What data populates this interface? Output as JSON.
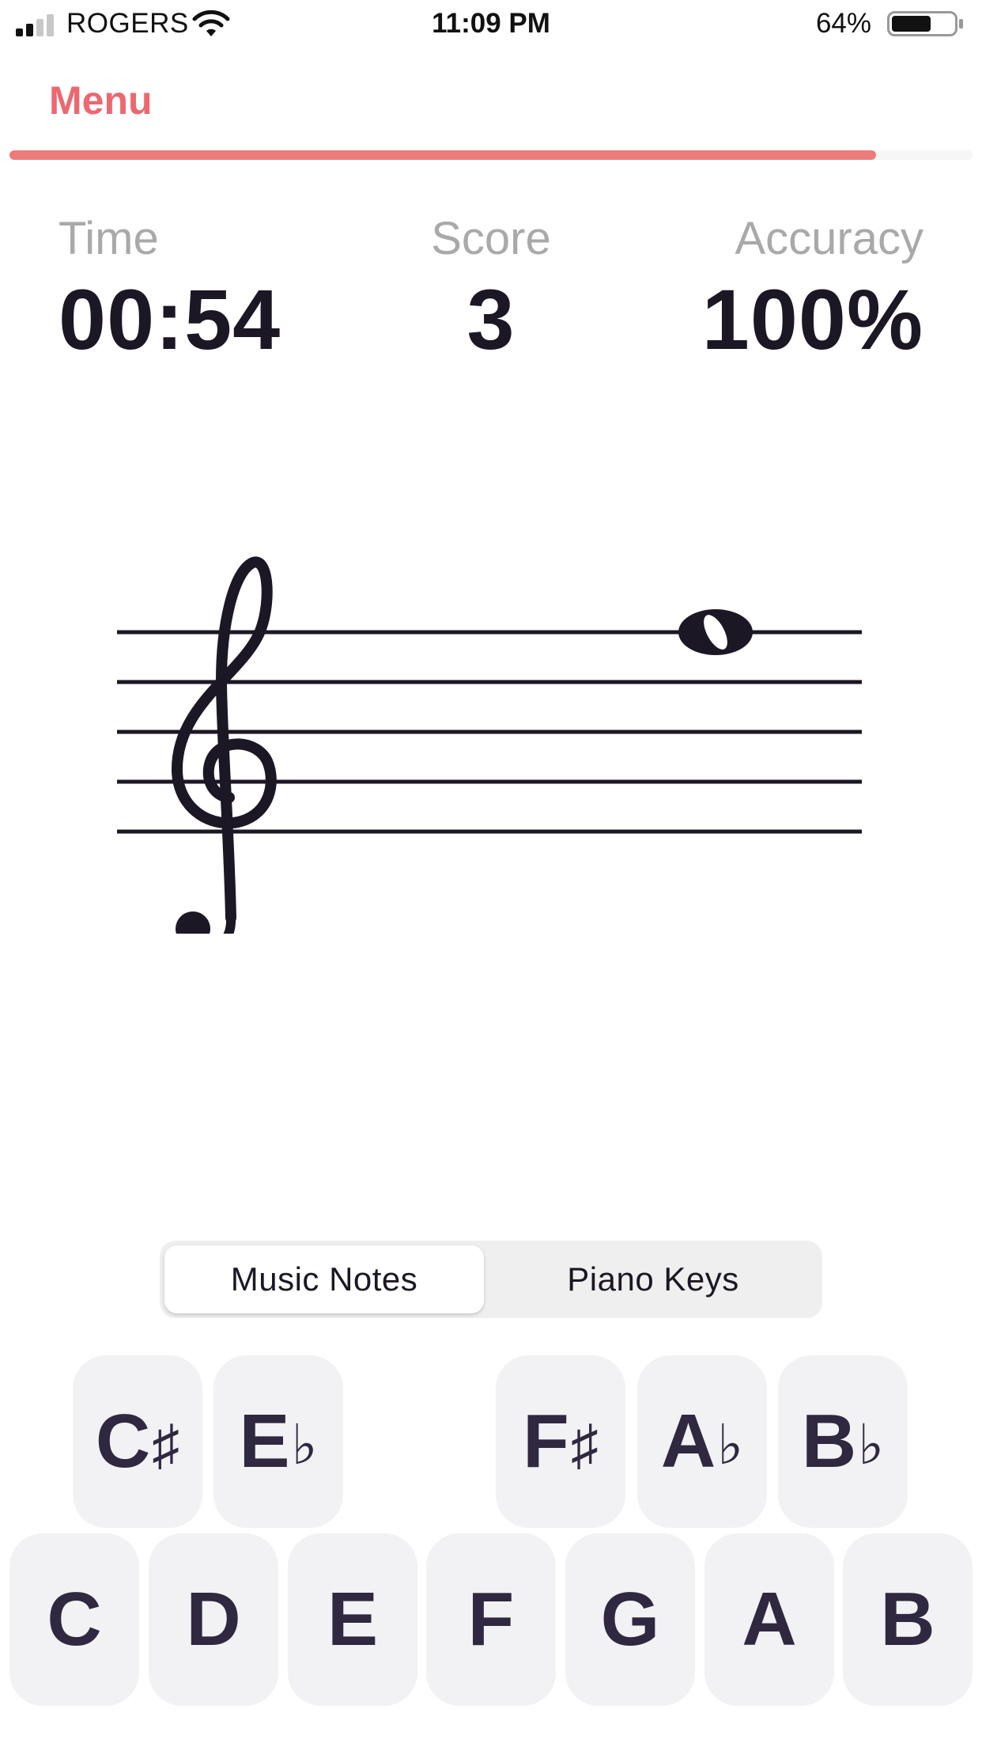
{
  "status_bar": {
    "carrier": "ROGERS",
    "time": "11:09 PM",
    "battery_percent": "64%",
    "battery_level": 0.64,
    "signal_bars": 2
  },
  "header": {
    "menu_label": "Menu",
    "progress": 0.9,
    "accent_color": "#ec6870"
  },
  "stats": {
    "time_label": "Time",
    "time_value": "00:54",
    "score_label": "Score",
    "score_value": "3",
    "accuracy_label": "Accuracy",
    "accuracy_value": "100%"
  },
  "staff": {
    "clef": "treble",
    "note": "whole note on top staff line (F5)"
  },
  "mode_toggle": {
    "options": [
      "Music Notes",
      "Piano Keys"
    ],
    "selected": "Music Notes"
  },
  "keys": {
    "accidentals": [
      {
        "letter": "C",
        "acc": "♯"
      },
      {
        "letter": "E",
        "acc": "♭"
      },
      {
        "letter": "F",
        "acc": "♯"
      },
      {
        "letter": "A",
        "acc": "♭"
      },
      {
        "letter": "B",
        "acc": "♭"
      }
    ],
    "naturals": [
      "C",
      "D",
      "E",
      "F",
      "G",
      "A",
      "B"
    ]
  }
}
